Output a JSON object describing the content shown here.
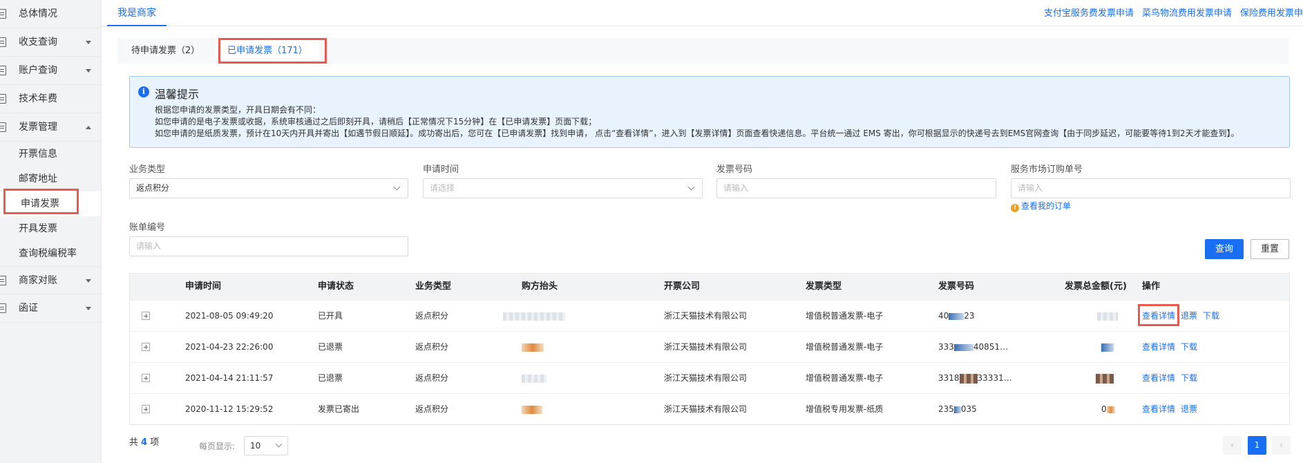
{
  "sidebar": {
    "items": [
      {
        "label": "总体情况",
        "has_caret": false
      },
      {
        "label": "收支查询",
        "has_caret": true
      },
      {
        "label": "账户查询",
        "has_caret": true
      },
      {
        "label": "技术年费",
        "has_caret": false
      },
      {
        "label": "发票管理",
        "has_caret": true,
        "expanded": true
      }
    ],
    "sub_items": [
      "开票信息",
      "邮寄地址",
      "申请发票",
      "开具发票",
      "查询税编税率"
    ],
    "active_sub": "申请发票",
    "bottom_items": [
      {
        "label": "商家对账",
        "has_caret": true
      },
      {
        "label": "函证",
        "has_caret": true
      }
    ]
  },
  "header": {
    "tab": "我是商家",
    "links": [
      "支付宝服务费发票申请",
      "菜鸟物流费用发票申请",
      "保险费用发票申"
    ]
  },
  "subtabs": [
    {
      "label": "待申请发票（2）",
      "active": false
    },
    {
      "label": "已申请发票（171）",
      "active": true
    }
  ],
  "notice": {
    "title": "温馨提示",
    "lines": [
      "根据您申请的发票类型，开具日期会有不同：",
      "如您申请的是电子发票或收据，系统审核通过之后即刻开具，请稍后【正常情况下15分钟】在【已申请发票】页面下载；",
      "如您申请的是纸质发票，预计在10天内开具并寄出【如遇节假日顺延】。成功寄出后，您可在【已申请发票】找到申请， 点击“查看详情”，进入到【发票详情】页面查看快递信息。平台统一通过 EMS 寄出，你可根据显示的快递号去到EMS官网查询【由于同步延迟，可能要等待1到2天才能查到】。"
    ]
  },
  "filters": {
    "business_type": {
      "label": "业务类型",
      "value": "返点积分"
    },
    "apply_time": {
      "label": "申请时间",
      "placeholder": "请选择"
    },
    "invoice_no": {
      "label": "发票号码",
      "placeholder": "请输入"
    },
    "market_order": {
      "label": "服务市场订购单号",
      "placeholder": "请输入",
      "hint": "查看我的订单"
    },
    "bill_no": {
      "label": "账单编号",
      "placeholder": "请输入"
    }
  },
  "buttons": {
    "search": "查询",
    "reset": "重置"
  },
  "table": {
    "headers": [
      "申请时间",
      "申请状态",
      "业务类型",
      "购方抬头",
      "开票公司",
      "发票类型",
      "发票号码",
      "发票总金额(元)",
      "操作"
    ],
    "rows": [
      {
        "time": "2021-08-05 09:49:20",
        "status": "已开具",
        "biz": "返点积分",
        "company": "浙江天猫技术有限公司",
        "type": "增值税普通发票-电子",
        "no_pre": "40",
        "no_post": "23",
        "actions": [
          "查看详情",
          "退票",
          "下载"
        ]
      },
      {
        "time": "2021-04-23 22:26:00",
        "status": "已退票",
        "biz": "返点积分",
        "company": "浙江天猫技术有限公司",
        "type": "增值税普通发票-电子",
        "no_pre": "333",
        "no_post": "40851…",
        "actions": [
          "查看详情",
          "下载"
        ]
      },
      {
        "time": "2021-04-14 21:11:57",
        "status": "已退票",
        "biz": "返点积分",
        "company": "浙江天猫技术有限公司",
        "type": "增值税普通发票-电子",
        "no_pre": "3318",
        "no_post": "33331…",
        "actions": [
          "查看详情",
          "下载"
        ]
      },
      {
        "time": "2020-11-12 15:29:52",
        "status": "发票已寄出",
        "biz": "返点积分",
        "company": "浙江天猫技术有限公司",
        "type": "增值税专用发票-纸质",
        "no_pre": "235",
        "no_post": "035",
        "amount_pre": "0",
        "actions": [
          "查看详情",
          "退票"
        ]
      }
    ]
  },
  "footer": {
    "total_prefix": "共",
    "total_count": "4",
    "total_suffix": "项",
    "page_size_label": "每页显示:",
    "page_size": "10",
    "current_page": "1"
  }
}
